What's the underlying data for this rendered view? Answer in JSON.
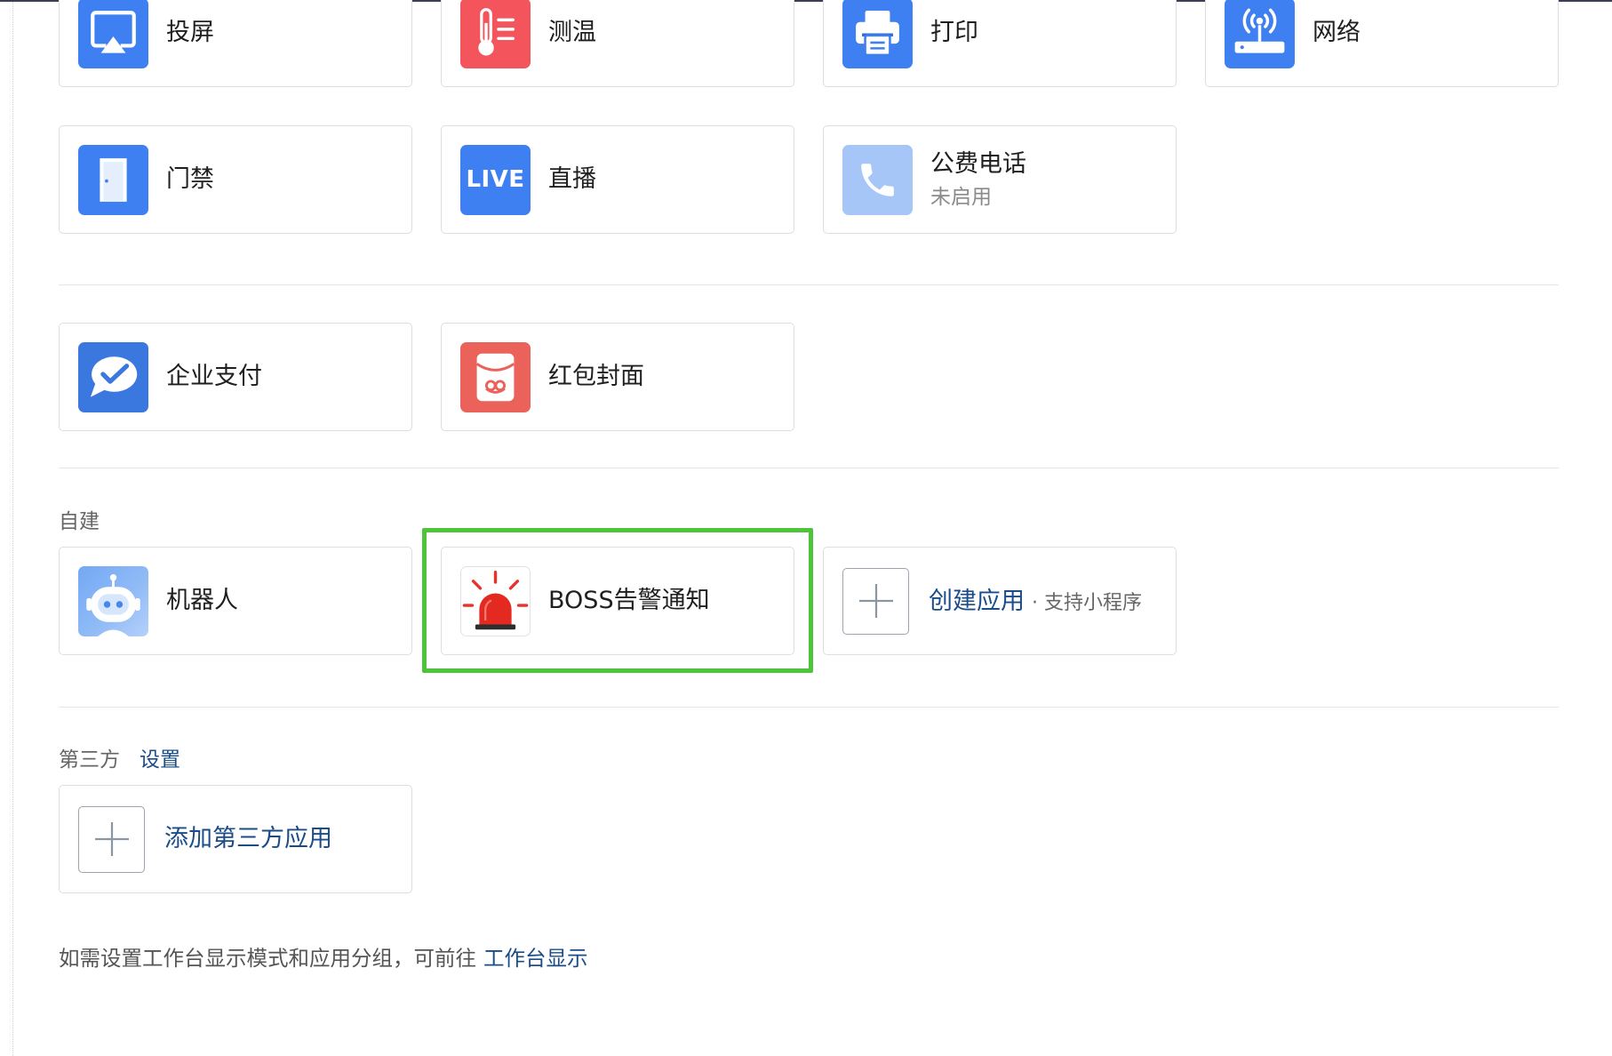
{
  "colors": {
    "icon_blue": "#3e7ff1",
    "icon_red": "#f4545c",
    "icon_light_blue": "#a6c6f8",
    "pay_blue": "#3a78df",
    "envelope_red": "#ea625a",
    "robot_blue": "#8fbaf6",
    "link_blue": "#1b4c8a",
    "highlight_green": "#4dc43a"
  },
  "top_apps": [
    {
      "label": "投屏",
      "icon": "screen-cast-icon"
    },
    {
      "label": "测温",
      "icon": "thermometer-icon"
    },
    {
      "label": "打印",
      "icon": "printer-icon"
    },
    {
      "label": "网络",
      "icon": "router-icon"
    },
    {
      "label": "门禁",
      "icon": "door-icon"
    },
    {
      "label": "直播",
      "icon": "live-icon",
      "icon_text": "LIVE"
    },
    {
      "label": "公费电话",
      "sublabel": "未启用",
      "icon": "phone-icon"
    }
  ],
  "payment_apps": [
    {
      "label": "企业支付",
      "icon": "wecom-pay-icon"
    },
    {
      "label": "红包封面",
      "icon": "red-envelope-icon"
    }
  ],
  "custom_section": {
    "title": "自建",
    "apps": [
      {
        "label": "机器人",
        "icon": "robot-icon"
      },
      {
        "label": "BOSS告警通知",
        "icon": "siren-icon",
        "highlighted": true
      }
    ],
    "create": {
      "label": "创建应用",
      "hint": "· 支持小程序",
      "icon": "plus-icon"
    }
  },
  "third_party_section": {
    "title": "第三方",
    "settings_link": "设置",
    "add": {
      "label": "添加第三方应用",
      "icon": "plus-icon"
    }
  },
  "footer": {
    "text": "如需设置工作台显示模式和应用分组，可前往",
    "link": "工作台显示"
  }
}
